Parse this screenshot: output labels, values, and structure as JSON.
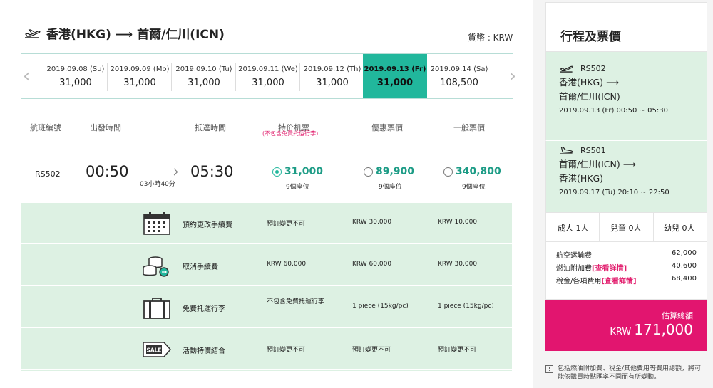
{
  "route": {
    "title": "香港(HKG) ⟶ 首爾/仁川(ICN)",
    "currency": "貨幣 : KRW"
  },
  "dates": [
    {
      "date": "2019.09.08 (Su)",
      "price": "31,000",
      "active": false
    },
    {
      "date": "2019.09.09 (Mo)",
      "price": "31,000",
      "active": false
    },
    {
      "date": "2019.09.10 (Tu)",
      "price": "31,000",
      "active": false
    },
    {
      "date": "2019.09.11 (We)",
      "price": "31,000",
      "active": false
    },
    {
      "date": "2019.09.12 (Th)",
      "price": "31,000",
      "active": false
    },
    {
      "date": "2019.09.13 (Fr)",
      "price": "31,000",
      "active": true
    },
    {
      "date": "2019.09.14 (Sa)",
      "price": "108,500",
      "active": false
    }
  ],
  "columns": {
    "flight": "航班編號",
    "depart": "出發時間",
    "arrive": "抵達時間",
    "special": "特价机票",
    "special_note": "(不包含免費托运行李)",
    "discount": "優惠票價",
    "normal": "一般票價"
  },
  "flight": {
    "number": "RS502",
    "depart": "00:50",
    "arrive": "05:30",
    "duration": "03小時40分",
    "fares": [
      {
        "price": "31,000",
        "seats": "9個座位",
        "selected": true
      },
      {
        "price": "89,900",
        "seats": "9個座位",
        "selected": false
      },
      {
        "price": "340,800",
        "seats": "9個座位",
        "selected": false
      }
    ]
  },
  "details": [
    {
      "icon": "calendar-icon",
      "label": "預約更改手續費",
      "v1": "預訂變更不可",
      "v2": "KRW 30,000",
      "v3": "KRW 10,000"
    },
    {
      "icon": "coins-icon",
      "label": "取消手續費",
      "v1": "KRW 60,000",
      "v2": "KRW 60,000",
      "v3": "KRW 30,000"
    },
    {
      "icon": "luggage-icon",
      "label": "免費托運行李",
      "v1": "不包含免費托運行李",
      "v2": "1 piece (15kg/pc)",
      "v3": "1 piece (15kg/pc)"
    },
    {
      "icon": "sale-tag-icon",
      "label": "活動特價結合",
      "v1": "預訂變更不可",
      "v2": "預訂變更不可",
      "v3": "預訂變更不可"
    }
  ],
  "summary": {
    "title": "行程及票價",
    "segments": [
      {
        "flight": "RS502",
        "line1": "香港(HKG) ⟶",
        "line2": "首爾/仁川(ICN)",
        "time": "2019.09.13 (Fr) 00:50 ~ 05:30"
      },
      {
        "flight": "RS501",
        "line1": "首爾/仁川(ICN) ⟶",
        "line2": "香港(HKG)",
        "time": "2019.09.17 (Tu) 20:10 ~ 22:50"
      }
    ],
    "pax": {
      "adult": "成人 1人",
      "child": "兒童 0人",
      "infant": "幼兒 0人"
    },
    "costs": [
      {
        "label": "航空运输费",
        "link": "",
        "amount": "62,000"
      },
      {
        "label": "燃油附加費",
        "link": "[查看詳情]",
        "amount": "40,600"
      },
      {
        "label": "稅金/各項費用",
        "link": "[查看詳情]",
        "amount": "68,400"
      }
    ],
    "total_label": "估算總額",
    "total_currency": "KRW",
    "total_value": "171,000",
    "note": "包括燃油附加費、稅金/其他費用等費用總額，將可能依購買時點匯率不同而有所變動。"
  },
  "colors": {
    "accent": "#21b79c",
    "pink": "#e2156f",
    "mint": "#ddf1e3"
  }
}
